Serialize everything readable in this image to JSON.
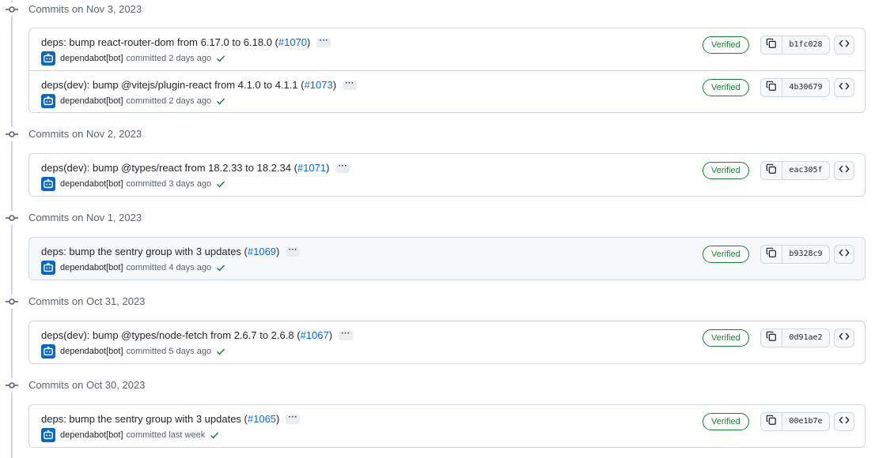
{
  "groups": [
    {
      "date": "Commits on Nov 3, 2023",
      "commits": [
        {
          "title": "deps: bump react-router-dom from 6.17.0 to 6.18.0 (",
          "pr": "#1070",
          "title_end": ")",
          "author": "dependabot[bot]",
          "action": "committed",
          "time": "2 days ago",
          "badge": "Verified",
          "sha": "b1fc028",
          "highlight": false
        },
        {
          "title": "deps(dev): bump @vitejs/plugin-react from 4.1.0 to 4.1.1 (",
          "pr": "#1073",
          "title_end": ")",
          "author": "dependabot[bot]",
          "action": "committed",
          "time": "2 days ago",
          "badge": "Verified",
          "sha": "4b30679",
          "highlight": false
        }
      ]
    },
    {
      "date": "Commits on Nov 2, 2023",
      "commits": [
        {
          "title": "deps(dev): bump @types/react from 18.2.33 to 18.2.34 (",
          "pr": "#1071",
          "title_end": ")",
          "author": "dependabot[bot]",
          "action": "committed",
          "time": "3 days ago",
          "badge": "Verified",
          "sha": "eac305f",
          "highlight": false
        }
      ]
    },
    {
      "date": "Commits on Nov 1, 2023",
      "commits": [
        {
          "title": "deps: bump the sentry group with 3 updates (",
          "pr": "#1069",
          "title_end": ")",
          "author": "dependabot[bot]",
          "action": "committed",
          "time": "4 days ago",
          "badge": "Verified",
          "sha": "b9328c9",
          "highlight": true
        }
      ]
    },
    {
      "date": "Commits on Oct 31, 2023",
      "commits": [
        {
          "title": "deps(dev): bump @types/node-fetch from 2.6.7 to 2.6.8 (",
          "pr": "#1067",
          "title_end": ")",
          "author": "dependabot[bot]",
          "action": "committed",
          "time": "5 days ago",
          "badge": "Verified",
          "sha": "0d91ae2",
          "highlight": false
        }
      ]
    },
    {
      "date": "Commits on Oct 30, 2023",
      "commits": [
        {
          "title": "deps: bump the sentry group with 3 updates (",
          "pr": "#1065",
          "title_end": ")",
          "author": "dependabot[bot]",
          "action": "committed",
          "time": "last week",
          "badge": "Verified",
          "sha": "00e1b7e",
          "highlight": false
        }
      ]
    }
  ],
  "colors": {
    "link": "#0969da",
    "verified": "#1a7f37",
    "avatar": "#0a66c2",
    "border": "#d0d7de"
  },
  "icons": {
    "group": "git-commit-icon",
    "avatar": "dependabot-icon",
    "status": "check-icon",
    "copy": "copy-icon",
    "browse": "code-icon"
  }
}
